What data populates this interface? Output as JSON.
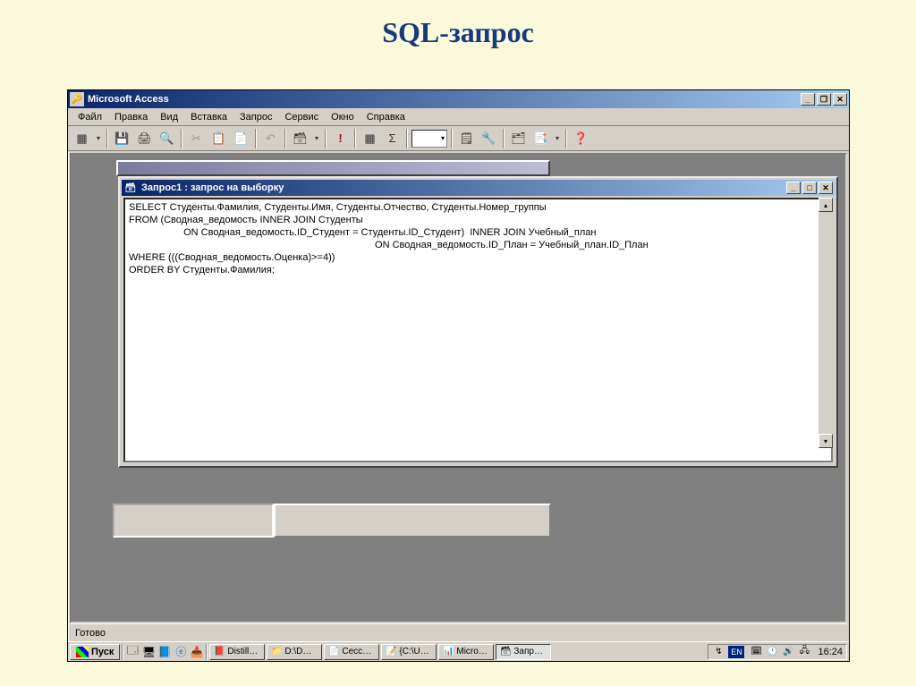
{
  "slide": {
    "title": "SQL-запрос"
  },
  "app": {
    "title": "Microsoft Access",
    "menu": [
      "Файл",
      "Правка",
      "Вид",
      "Вставка",
      "Запрос",
      "Сервис",
      "Окно",
      "Справка"
    ],
    "status": "Готово"
  },
  "child_window": {
    "title": "Запрос1 : запрос на выборку",
    "sql_lines": [
      "SELECT Студенты.Фамилия, Студенты.Имя, Студенты.Отчество, Студенты.Номер_группы",
      "FROM (Сводная_ведомость INNER JOIN Студенты",
      "                    ON Сводная_ведомость.ID_Студент = Студенты.ID_Студент)  INNER JOIN Учебный_план",
      "                                                                                          ON Сводная_ведомость.ID_План = Учебный_план.ID_План",
      "",
      "WHERE (((Сводная_ведомость.Оценка)>=4))",
      "ORDER BY Студенты.Фамилия;"
    ]
  },
  "taskbar": {
    "start": "Пуск",
    "tasks": [
      {
        "label": "Distill…",
        "icon": "📕"
      },
      {
        "label": "D:\\D…",
        "icon": "📁"
      },
      {
        "label": "Сесс…",
        "icon": "📄"
      },
      {
        "label": "{C:\\U…",
        "icon": "📝"
      },
      {
        "label": "Micro…",
        "icon": "📊"
      },
      {
        "label": "Запр…",
        "icon": "🗃",
        "active": true
      }
    ],
    "lang": "EN",
    "clock": "16:24"
  },
  "toolbar_icons": [
    "🗎",
    "💾",
    "🖨",
    "🔍",
    "✂",
    "📋",
    "📄",
    "↶",
    "↷",
    "▦",
    "!",
    "▶",
    "Σ",
    "📋",
    "🔧",
    "🗂",
    "📑",
    "❓"
  ]
}
